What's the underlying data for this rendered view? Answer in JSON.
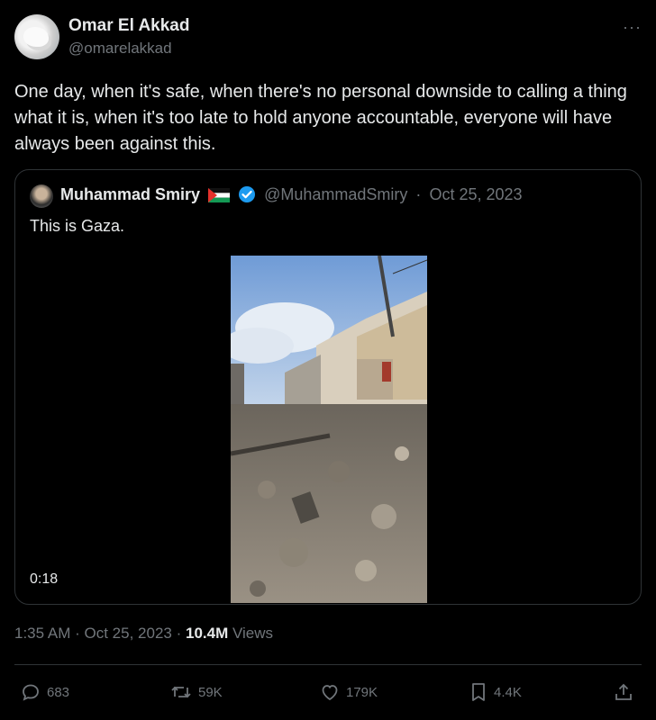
{
  "author": {
    "name": "Omar El Akkad",
    "handle": "@omarelakkad"
  },
  "more_icon": "more-horizontal-icon",
  "tweet": {
    "text": "One day, when it's safe, when there's no personal downside to calling a thing what it is, when it's too late to hold anyone accountable, everyone will have always been against this."
  },
  "quote": {
    "name": "Muhammad Smiry",
    "handle": "@MuhammadSmiry",
    "date": "Oct 25, 2023",
    "separator": "·",
    "text": "This is Gaza.",
    "video_duration": "0:18"
  },
  "meta": {
    "time": "1:35 AM",
    "date": "Oct 25, 2023",
    "separator": "·",
    "views_count": "10.4M",
    "views_label": "Views"
  },
  "actions": {
    "replies": "683",
    "reposts": "59K",
    "likes": "179K",
    "bookmarks": "4.4K"
  },
  "colors": {
    "background": "#000000",
    "text": "#e7e9ea",
    "muted": "#71767b",
    "verified": "#1d9bf0",
    "border": "#2f3336"
  }
}
